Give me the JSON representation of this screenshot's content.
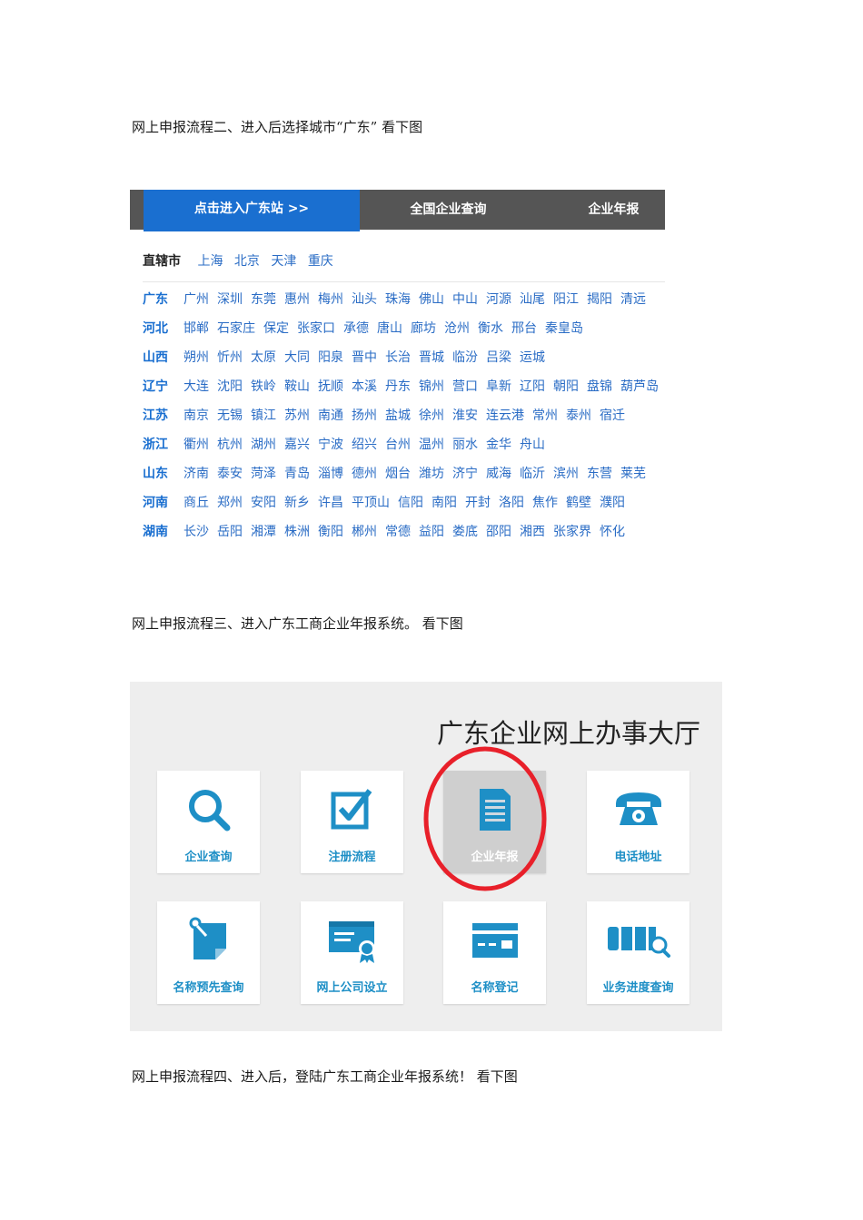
{
  "paragraphs": {
    "step2": "网上申报流程二、进入后选择城市“广东”   看下图",
    "step3": "网上申报流程三、进入广东工商企业年报系统。 看下图",
    "step4": "网上申报流程四、进入后，登陆广东工商企业年报系统！ 看下图"
  },
  "city_selector": {
    "tabs": [
      "点击进入广东站 >>",
      "全国企业查询",
      "企业年报"
    ],
    "direct_label": "直辖市",
    "direct_cities": [
      "上海",
      "北京",
      "天津",
      "重庆"
    ],
    "provinces": [
      {
        "name": "广东",
        "cities": [
          "广州",
          "深圳",
          "东莞",
          "惠州",
          "梅州",
          "汕头",
          "珠海",
          "佛山",
          "中山",
          "河源",
          "汕尾",
          "阳江",
          "揭阳",
          "清远"
        ]
      },
      {
        "name": "河北",
        "cities": [
          "邯郸",
          "石家庄",
          "保定",
          "张家口",
          "承德",
          "唐山",
          "廊坊",
          "沧州",
          "衡水",
          "邢台",
          "秦皇岛"
        ]
      },
      {
        "name": "山西",
        "cities": [
          "朔州",
          "忻州",
          "太原",
          "大同",
          "阳泉",
          "晋中",
          "长治",
          "晋城",
          "临汾",
          "吕梁",
          "运城"
        ]
      },
      {
        "name": "辽宁",
        "cities": [
          "大连",
          "沈阳",
          "铁岭",
          "鞍山",
          "抚顺",
          "本溪",
          "丹东",
          "锦州",
          "营口",
          "阜新",
          "辽阳",
          "朝阳",
          "盘锦",
          "葫芦岛"
        ]
      },
      {
        "name": "江苏",
        "cities": [
          "南京",
          "无锡",
          "镇江",
          "苏州",
          "南通",
          "扬州",
          "盐城",
          "徐州",
          "淮安",
          "连云港",
          "常州",
          "泰州",
          "宿迁"
        ]
      },
      {
        "name": "浙江",
        "cities": [
          "衢州",
          "杭州",
          "湖州",
          "嘉兴",
          "宁波",
          "绍兴",
          "台州",
          "温州",
          "丽水",
          "金华",
          "舟山"
        ]
      },
      {
        "name": "山东",
        "cities": [
          "济南",
          "泰安",
          "菏泽",
          "青岛",
          "淄博",
          "德州",
          "烟台",
          "潍坊",
          "济宁",
          "威海",
          "临沂",
          "滨州",
          "东营",
          "莱芜"
        ]
      },
      {
        "name": "河南",
        "cities": [
          "商丘",
          "郑州",
          "安阳",
          "新乡",
          "许昌",
          "平顶山",
          "信阳",
          "南阳",
          "开封",
          "洛阳",
          "焦作",
          "鹤壁",
          "濮阳"
        ]
      },
      {
        "name": "湖南",
        "cities": [
          "长沙",
          "岳阳",
          "湘潭",
          "株洲",
          "衡阳",
          "郴州",
          "常德",
          "益阳",
          "娄底",
          "邵阳",
          "湘西",
          "张家界",
          "怀化"
        ]
      }
    ]
  },
  "hall": {
    "title": "广东企业网上办事大厅",
    "tiles": [
      {
        "label": "企业查询",
        "icon": "search-icon"
      },
      {
        "label": "注册流程",
        "icon": "checkbox-icon"
      },
      {
        "label": "企业年报",
        "icon": "document-icon",
        "selected": true
      },
      {
        "label": "电话地址",
        "icon": "telephone-icon"
      },
      {
        "label": "名称预先查询",
        "icon": "sticky-note-icon"
      },
      {
        "label": "网上公司设立",
        "icon": "certificate-icon"
      },
      {
        "label": "名称登记",
        "icon": "card-icon"
      },
      {
        "label": "业务进度查询",
        "icon": "progress-search-icon"
      }
    ],
    "accent_color": "#1e8fc6",
    "highlight_color": "#e8202a"
  }
}
